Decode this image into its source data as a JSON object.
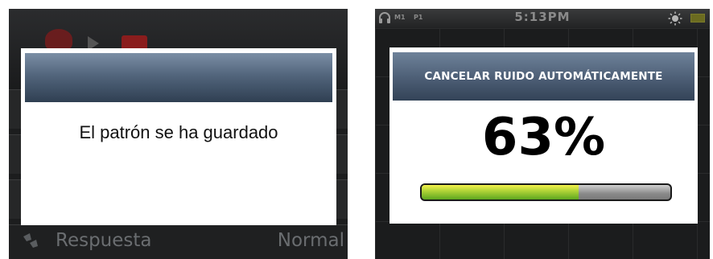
{
  "left_screen": {
    "dialog_message": "El patrón se ha guardado",
    "bottom_row": {
      "label": "Respuesta",
      "value": "Normal"
    }
  },
  "right_screen": {
    "status": {
      "m1": "M1",
      "p1": "P1",
      "time": "5:13PM"
    },
    "dialog_title": "CANCELAR RUIDO AUTOMÁTICAMENTE",
    "percent_text": "63%",
    "progress_fraction": 0.63
  },
  "colors": {
    "titlebar_top": "#7b8ea5",
    "titlebar_bottom": "#2f3f52",
    "progress_green": "#5da71f",
    "progress_yellow": "#f5f14a"
  },
  "icons": [
    "headphones-icon",
    "sun-icon",
    "battery-icon",
    "response-icon"
  ]
}
